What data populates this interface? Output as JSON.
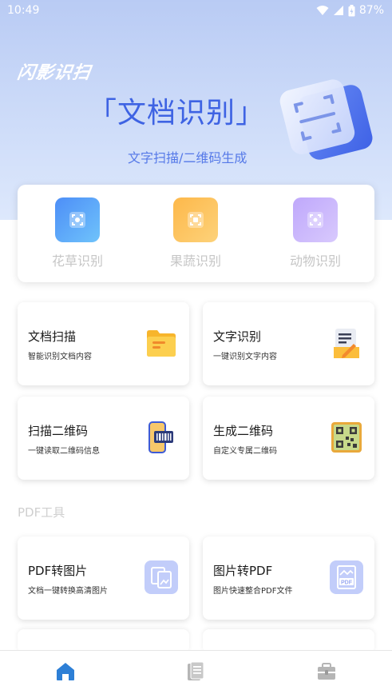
{
  "status": {
    "time": "10:49",
    "battery": "87%"
  },
  "hero": {
    "logo": "闪影识扫",
    "title": "「文档识别」",
    "subtitle": "文字扫描/二维码生成"
  },
  "categories": [
    {
      "label": "花草识别",
      "color": "#4f8ff5"
    },
    {
      "label": "果蔬识别",
      "color": "#fdbf4f"
    },
    {
      "label": "动物识别",
      "color": "#c7b2fb"
    }
  ],
  "features": [
    {
      "title": "文档扫描",
      "desc": "智能识别文档内容"
    },
    {
      "title": "文字识别",
      "desc": "一键识别文字内容"
    },
    {
      "title": "扫描二维码",
      "desc": "一键读取二维码信息"
    },
    {
      "title": "生成二维码",
      "desc": "自定义专属二维码"
    }
  ],
  "pdf_section": {
    "label": "PDF工具",
    "items": [
      {
        "title": "PDF转图片",
        "desc": "文档一键转换高清图片"
      },
      {
        "title": "图片转PDF",
        "desc": "图片快速整合PDF文件"
      }
    ]
  },
  "nav": {
    "items": [
      "home-icon",
      "document-list-icon",
      "toolbox-icon"
    ],
    "active_color": "#2d7fd6",
    "inactive_color": "#b5b5b5"
  }
}
